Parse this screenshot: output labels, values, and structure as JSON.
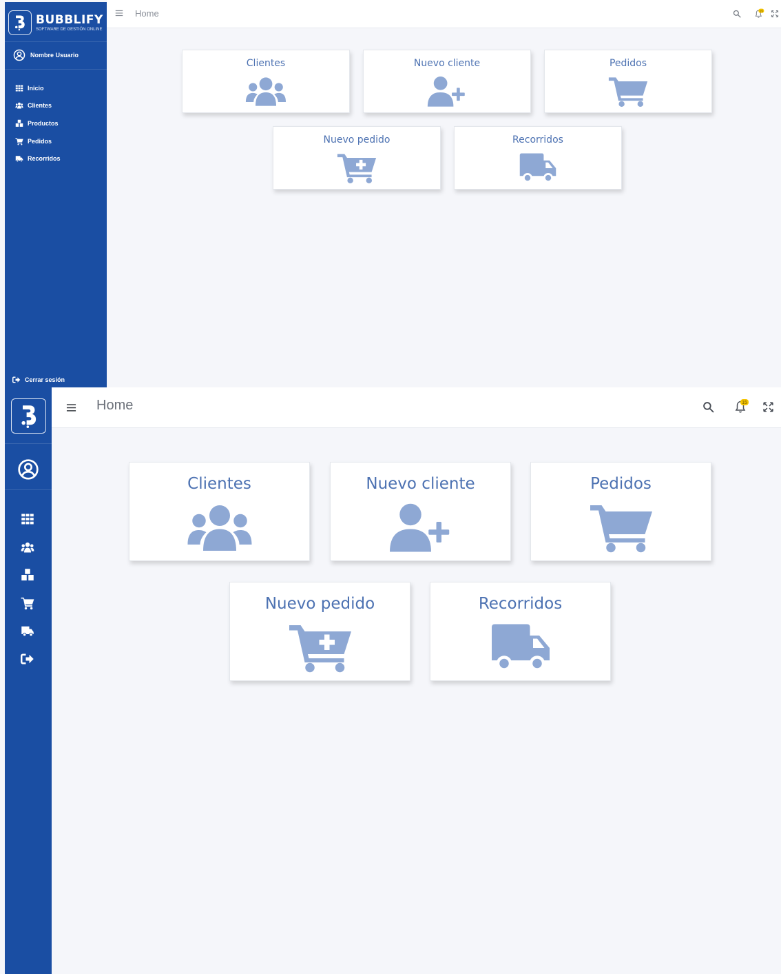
{
  "app": {
    "brand_name": "BUBBLIFY",
    "brand_tagline": "SOFTWARE DE GESTIÓN ONLINE"
  },
  "user": {
    "name": "Nombre Usuario",
    "icon": "user-circle-icon"
  },
  "sidebar": {
    "items": [
      {
        "label": "Inicio",
        "icon": "grid-icon"
      },
      {
        "label": "Clientes",
        "icon": "users-icon"
      },
      {
        "label": "Productos",
        "icon": "boxes-icon"
      },
      {
        "label": "Pedidos",
        "icon": "cart-icon"
      },
      {
        "label": "Recorridos",
        "icon": "truck-icon"
      }
    ],
    "logout_label": "Cerrar sesión",
    "logout_icon": "logout-icon"
  },
  "topbar": {
    "breadcrumb": "Home",
    "notification_count": "15",
    "icons": [
      "menu-icon",
      "search-icon",
      "bell-icon",
      "fullscreen-icon"
    ]
  },
  "dashboard": {
    "cards": [
      {
        "title": "Clientes",
        "icon": "users-icon"
      },
      {
        "title": "Nuevo cliente",
        "icon": "user-plus-icon"
      },
      {
        "title": "Pedidos",
        "icon": "cart-icon"
      },
      {
        "title": "Nuevo pedido",
        "icon": "cart-plus-icon"
      },
      {
        "title": "Recorridos",
        "icon": "truck-icon"
      }
    ]
  },
  "colors": {
    "sidebar": "#1a4ea3",
    "card_title": "#4d72b2",
    "card_icon": "#8ea8d4",
    "background": "#f5f6fa",
    "badge": "#f5c400"
  }
}
